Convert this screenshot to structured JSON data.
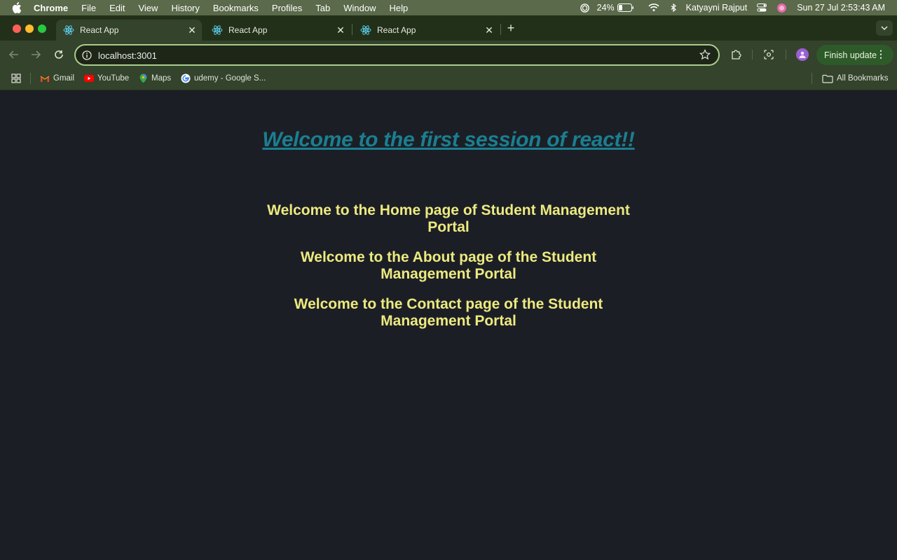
{
  "menubar": {
    "app_name": "Chrome",
    "items": [
      "File",
      "Edit",
      "View",
      "History",
      "Bookmarks",
      "Profiles",
      "Tab",
      "Window",
      "Help"
    ],
    "battery": "24%",
    "user": "Katyayni Rajput",
    "datetime": "Sun 27 Jul  2:53:43 AM"
  },
  "tabs": [
    {
      "title": "React App",
      "active": true
    },
    {
      "title": "React App",
      "active": false
    },
    {
      "title": "React App",
      "active": false
    }
  ],
  "toolbar": {
    "url": "localhost:3001",
    "finish_update_label": "Finish update"
  },
  "bookmarks": {
    "items": [
      "Gmail",
      "YouTube",
      "Maps",
      "udemy - Google S..."
    ],
    "all_bookmarks": "All Bookmarks"
  },
  "page": {
    "title": "Welcome to the first session of react!!",
    "home_line1": "Welcome to the Home page of Student Management",
    "home_line2": "Portal",
    "about_line1": "Welcome to the About page of the Student",
    "about_line2": "Management Portal",
    "contact_line1": "Welcome to the Contact page of the Student",
    "contact_line2": "Management Portal"
  },
  "colors": {
    "page_background": "#1c1e26",
    "title_color": "#1a7f8f",
    "heading_color": "#ecea7f",
    "browser_frame": "#34432b"
  }
}
